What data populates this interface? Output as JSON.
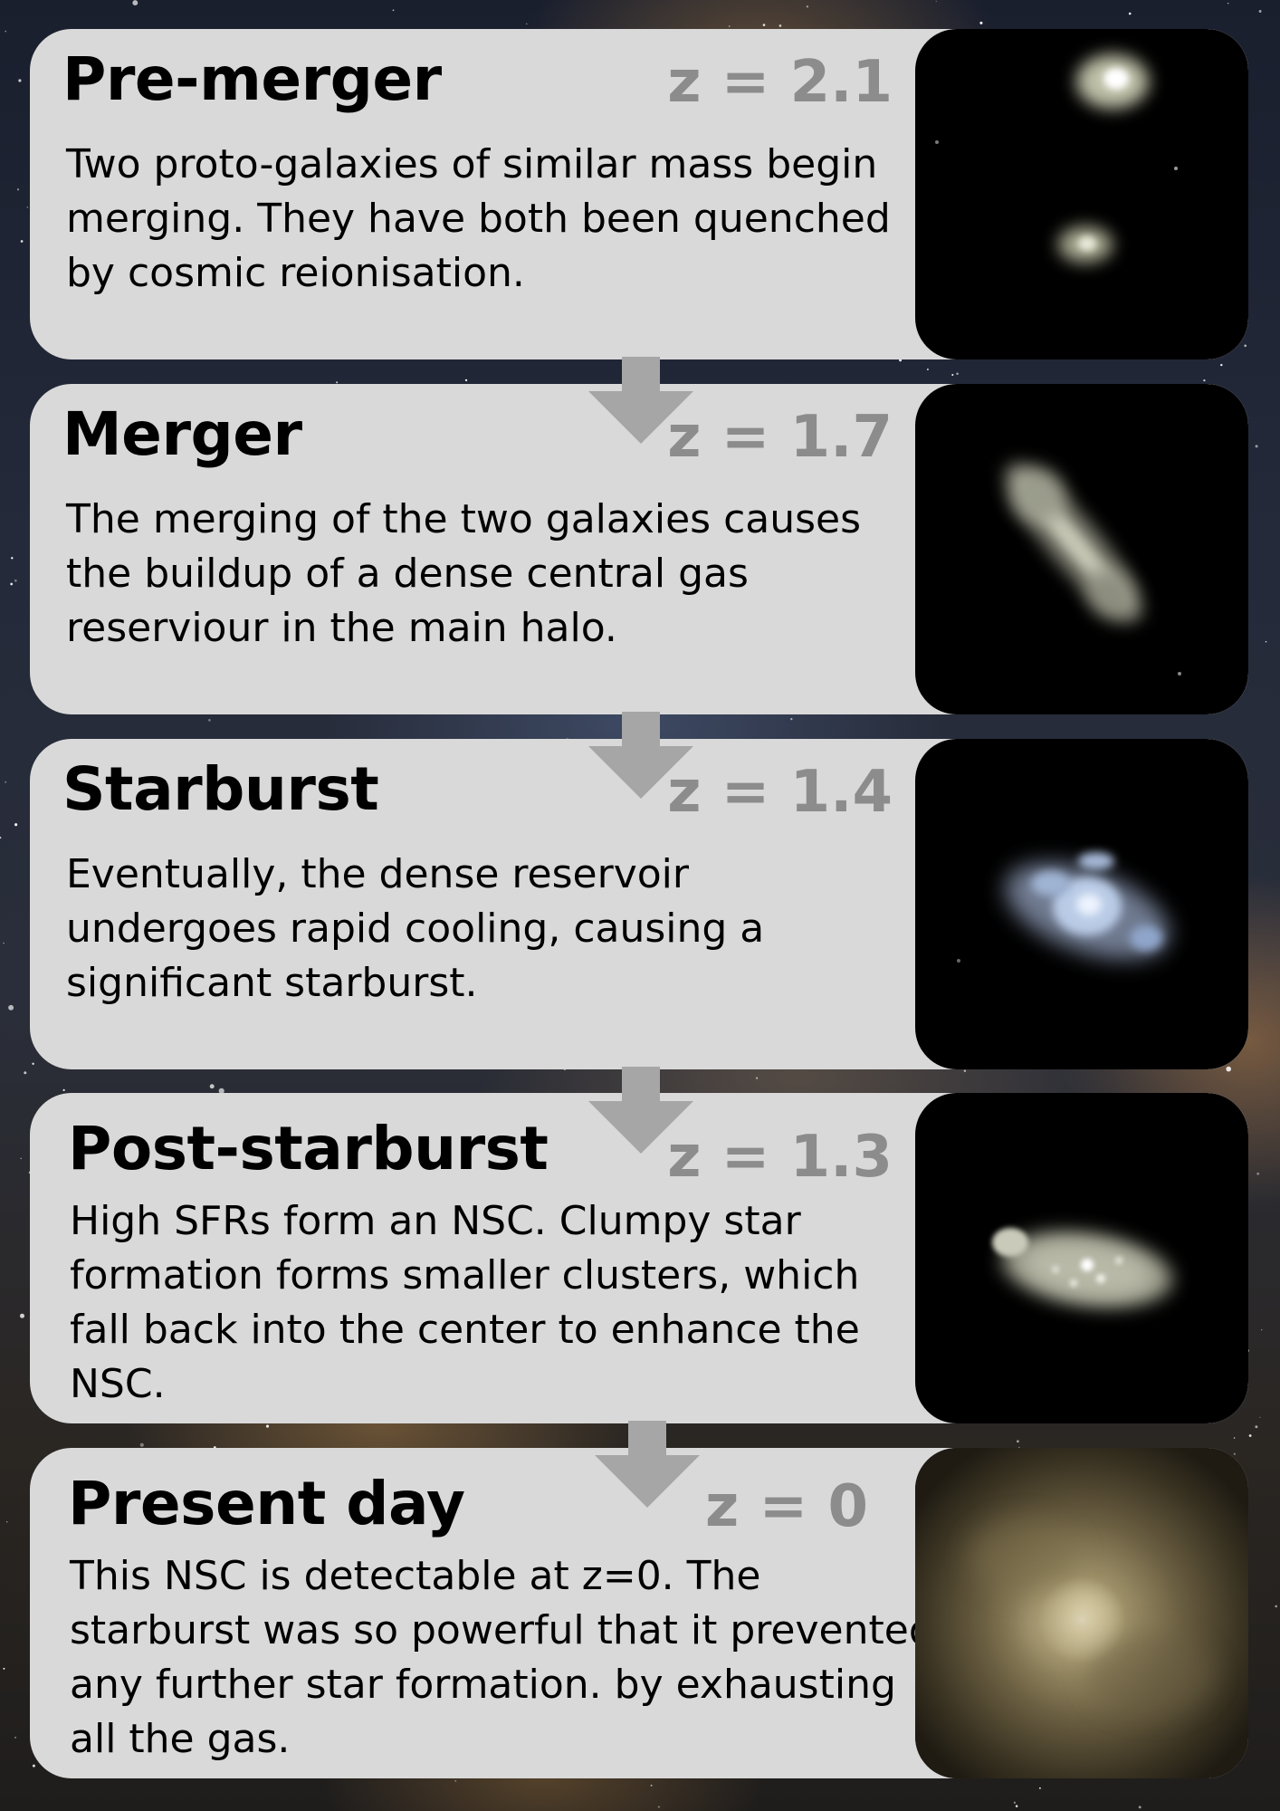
{
  "stages": [
    {
      "title": "Pre-merger",
      "redshift": "z = 2.1",
      "description": "Two proto-galaxies of similar mass begin merging. They have both been quenched by cosmic reionisation."
    },
    {
      "title": "Merger",
      "redshift": "z = 1.7",
      "description": "The merging of the two galaxies causes the buildup of a dense central gas reserviour in the main halo."
    },
    {
      "title": "Starburst",
      "redshift": "z = 1.4",
      "description": "Eventually, the dense reservoir undergoes rapid cooling, causing a significant starburst."
    },
    {
      "title": "Post-starburst",
      "redshift": "z = 1.3",
      "description": "High SFRs form an NSC. Clumpy star formation forms smaller clusters, which fall back into the center to enhance the NSC."
    },
    {
      "title": "Present day",
      "redshift": "z = 0",
      "description": "This NSC is detectable at z=0. The starburst was so powerful that it prevented any further star formation. by exhausting all the gas."
    }
  ],
  "colors": {
    "card_background": "#d9d9d9",
    "title_text": "#000000",
    "redshift_text": "#8c8c8c",
    "arrow": "#a6a6a6",
    "thumbnail_background": "#000000"
  }
}
